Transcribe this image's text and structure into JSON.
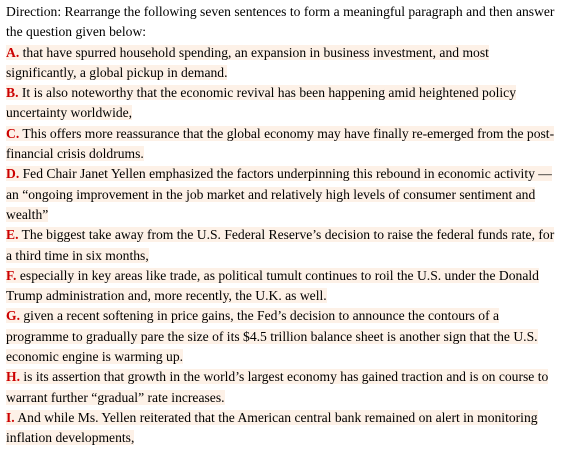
{
  "direction": "Direction: Rearrange the following seven sentences to form a meaningful paragraph and then answer the question given below:",
  "accent_color": "#cc0000",
  "highlight_color": "#fdf1e7",
  "sentences": [
    {
      "letter": "A.",
      "text": " that have spurred household spending, an expansion in business investment, and most significantly, a global pickup in demand."
    },
    {
      "letter": "B.",
      "text": " It is also noteworthy that the economic revival has been happening amid heightened policy uncertainty worldwide,"
    },
    {
      "letter": "C.",
      "text": " This offers more reassurance that the global economy may have finally re-emerged from the post-financial crisis doldrums."
    },
    {
      "letter": "D.",
      "text": " Fed Chair Janet Yellen emphasized the factors underpinning this rebound in economic activity — an “ongoing improvement in the job market and relatively high levels of consumer sentiment and wealth”"
    },
    {
      "letter": "E.",
      "text": " The biggest take away from the U.S. Federal Reserve’s decision to raise the federal funds rate, for a third time in six months,"
    },
    {
      "letter": "F.",
      "text": " especially in key areas like trade, as political tumult continues to roil the U.S. under the Donald Trump administration and, more recently, the U.K. as well."
    },
    {
      "letter": "G.",
      "text": " given a recent softening in price gains, the Fed’s decision to announce the contours of a programme to gradually pare the size of its $4.5 trillion balance sheet is another sign that the U.S. economic engine is warming up."
    },
    {
      "letter": "H.",
      "text": " is its assertion that growth in the world’s largest economy has gained traction and is on course to warrant further “gradual” rate increases."
    },
    {
      "letter": "I.",
      "text": " And while Ms. Yellen reiterated that the American central bank remained on alert in monitoring inflation developments,"
    }
  ]
}
